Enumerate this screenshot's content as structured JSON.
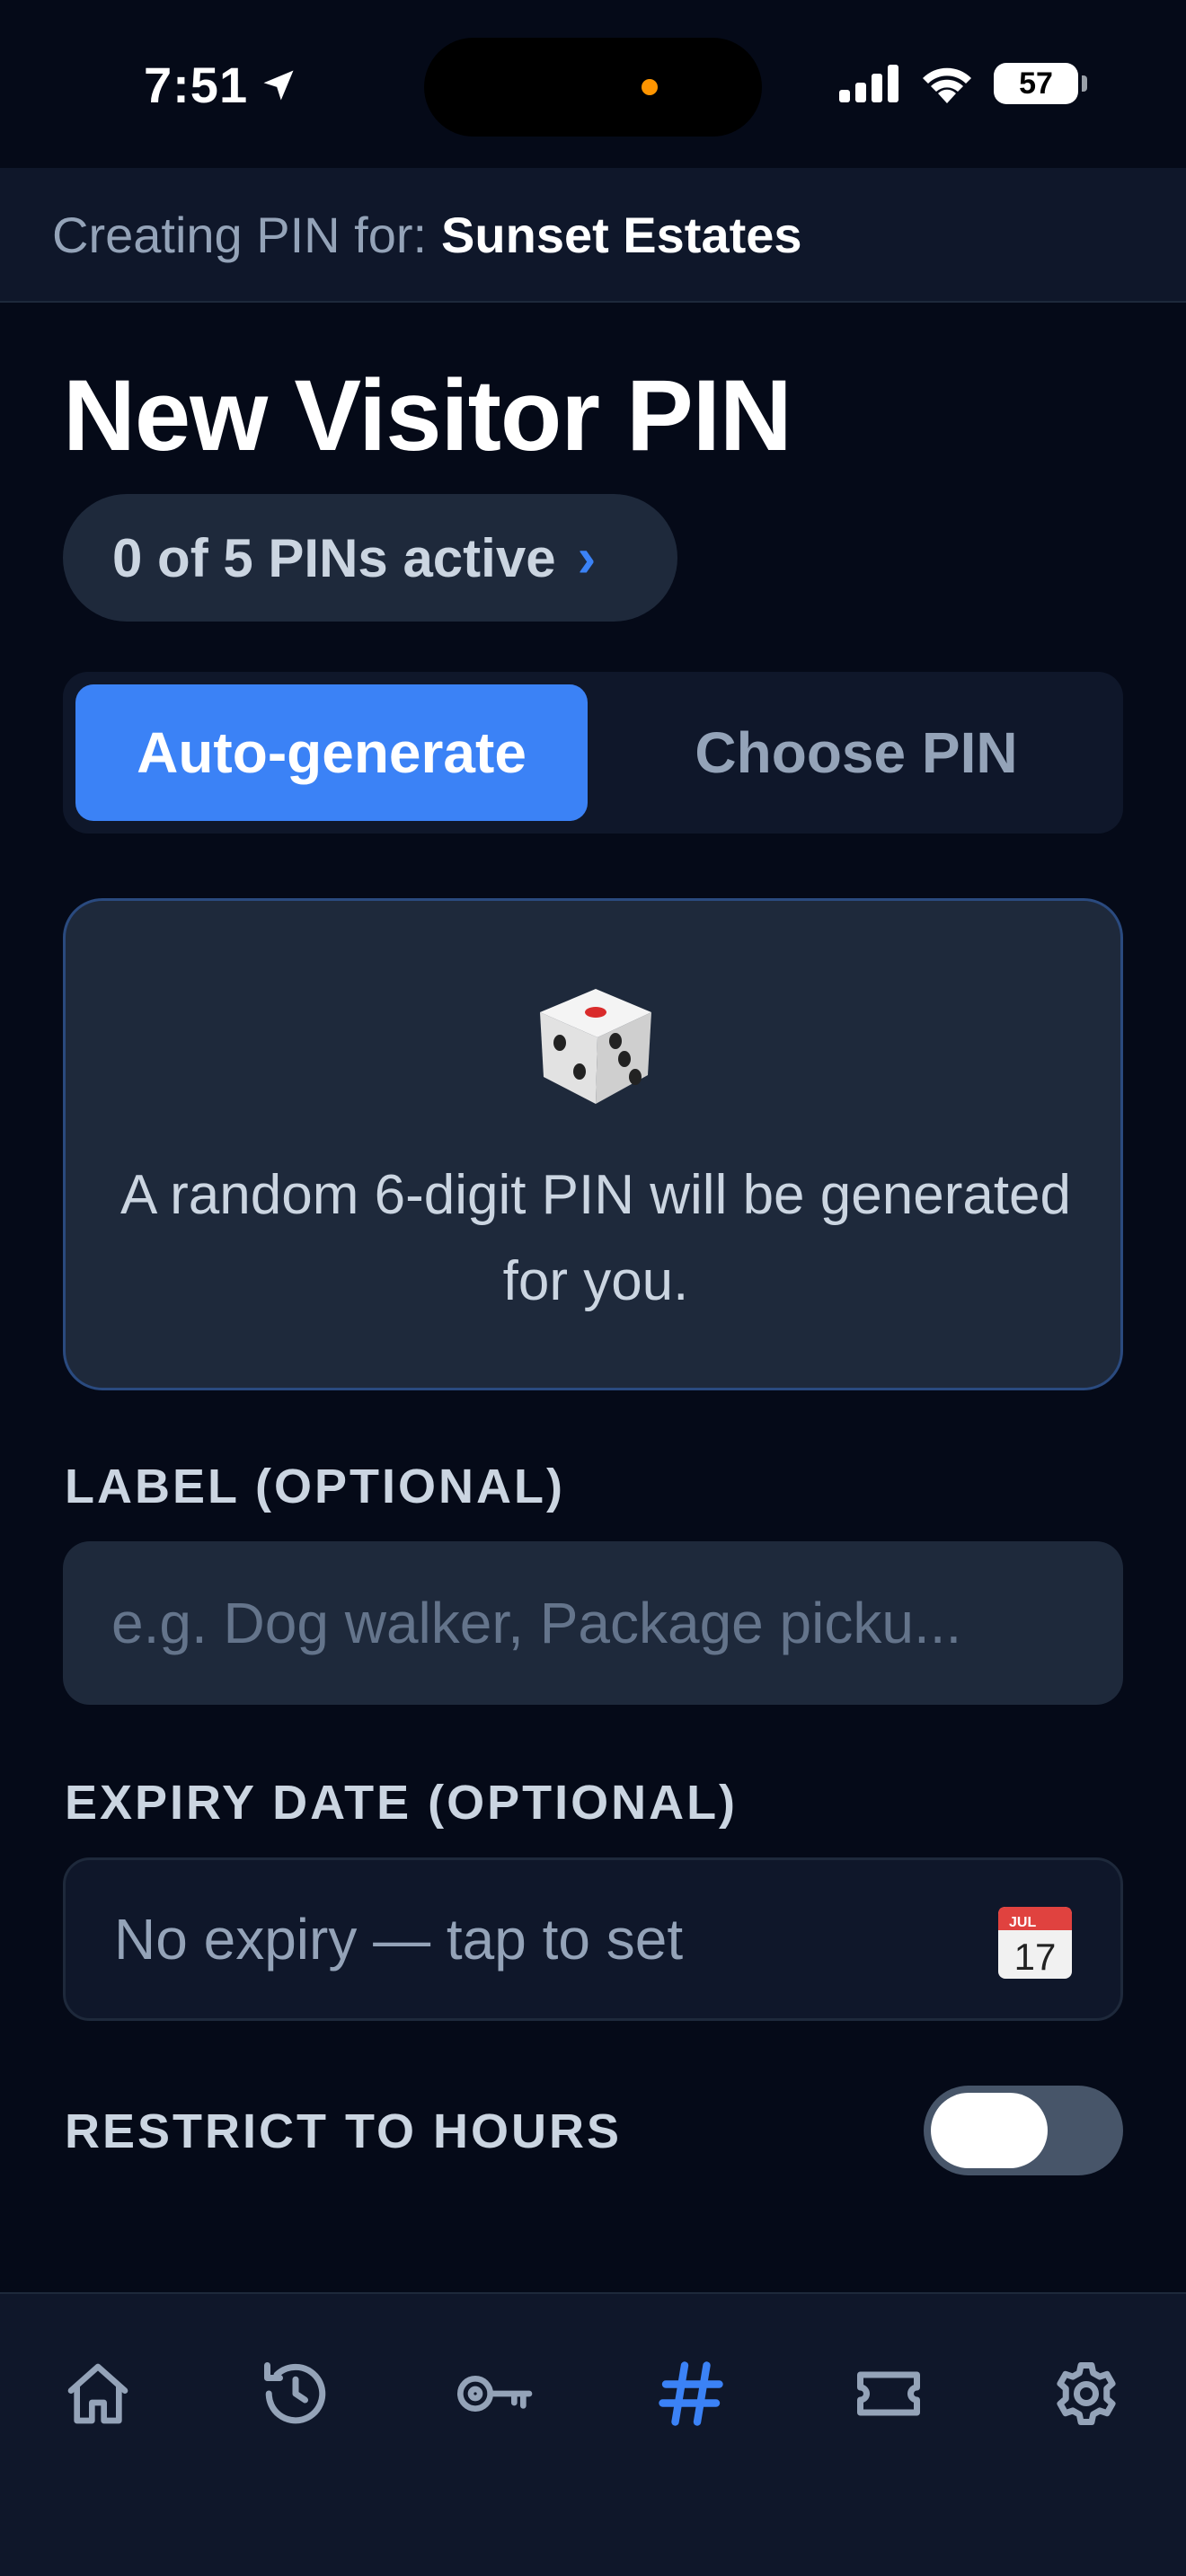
{
  "status_bar": {
    "time": "7:51",
    "battery": "57"
  },
  "context": {
    "prefix": "Creating PIN for:",
    "name": "Sunset Estates"
  },
  "title": "New Visitor PIN",
  "pin_count": {
    "label": "0 of 5 PINs active",
    "chevron": "›"
  },
  "mode_toggle": {
    "auto_label": "Auto-generate",
    "choose_label": "Choose PIN",
    "selected": "Auto-generate"
  },
  "info_card": {
    "icon": "dice-icon",
    "text": "A random 6-digit PIN will be generated for you."
  },
  "label_field": {
    "label": "LABEL (OPTIONAL)",
    "placeholder": "e.g. Dog walker, Package picku...",
    "value": ""
  },
  "expiry_field": {
    "label": "EXPIRY DATE (OPTIONAL)",
    "placeholder": "No expiry — tap to set",
    "calendar_month": "JUL",
    "calendar_day": "17"
  },
  "restrict_hours": {
    "label": "RESTRICT TO HOURS",
    "enabled": false
  },
  "tabs": [
    {
      "name": "home",
      "icon": "home-icon",
      "active": false
    },
    {
      "name": "history",
      "icon": "history-icon",
      "active": false
    },
    {
      "name": "keys",
      "icon": "key-icon",
      "active": false
    },
    {
      "name": "pins",
      "icon": "hash-icon",
      "active": true
    },
    {
      "name": "passes",
      "icon": "ticket-icon",
      "active": false
    },
    {
      "name": "settings",
      "icon": "gear-icon",
      "active": false
    }
  ],
  "colors": {
    "accent": "#3b82f6",
    "background": "#050a18",
    "surface": "#1e293b",
    "muted": "#94a3b8"
  }
}
